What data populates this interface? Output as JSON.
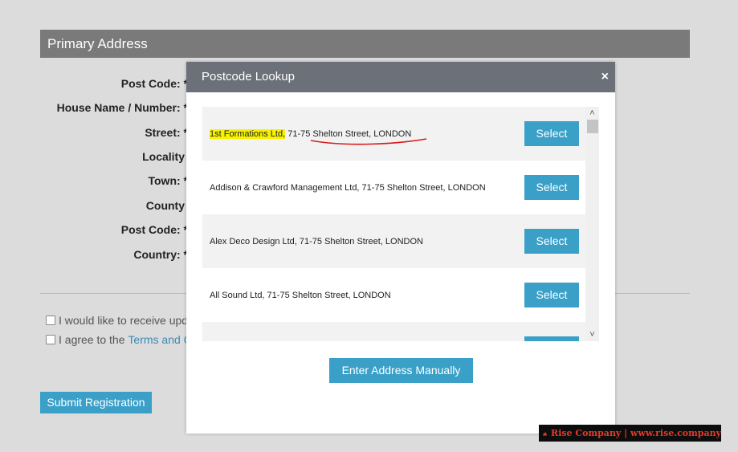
{
  "section": {
    "title": "Primary Address"
  },
  "form": {
    "labels": [
      "Post Code: *",
      "House Name / Number: *",
      "Street: *",
      "Locality",
      "Town: *",
      "County",
      "Post Code: *",
      "Country: *"
    ]
  },
  "checkboxes": {
    "updates_label": "I would like to receive updat",
    "terms_prefix": "I agree to the ",
    "terms_link": "Terms and Co"
  },
  "submit": {
    "label": "Submit Registration"
  },
  "modal": {
    "title": "Postcode Lookup",
    "close_label": "×",
    "select_label": "Select",
    "manual_label": "Enter Address Manually",
    "addresses": [
      {
        "company": "1st Formations Ltd,",
        "address": " 71-75 Shelton Street, LONDON"
      },
      {
        "company": "Addison & Crawford Management Ltd,",
        "address": " 71-75 Shelton Street, LONDON"
      },
      {
        "company": "Alex Deco Design Ltd,",
        "address": " 71-75 Shelton Street, LONDON"
      },
      {
        "company": "All Sound Ltd,",
        "address": " 71-75 Shelton Street, LONDON"
      }
    ]
  },
  "watermark": {
    "text": "Rise Company | www.rise.company"
  },
  "colors": {
    "accent": "#3aa0c8",
    "modal_header": "#6b7079",
    "highlight": "#f7f200",
    "annotation": "#d81b1b"
  }
}
